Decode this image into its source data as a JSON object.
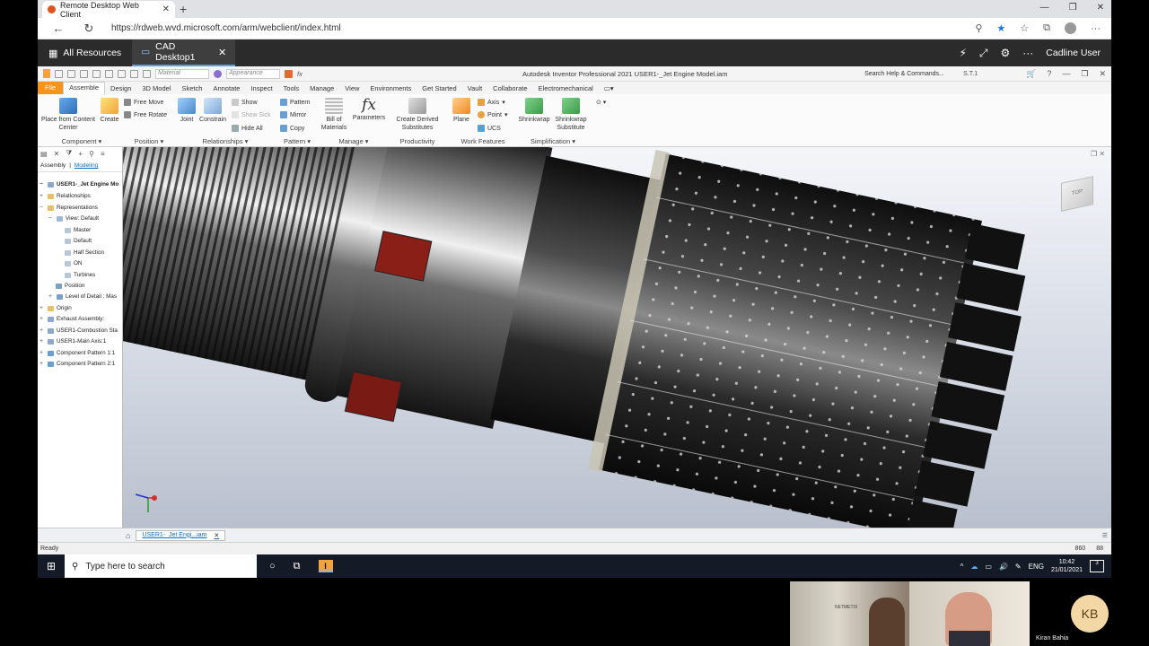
{
  "browser": {
    "tab_title": "Remote Desktop Web Client",
    "new_tab": "+",
    "url": "https://rdweb.wvd.microsoft.com/arm/webclient/index.html",
    "window_controls": [
      "—",
      "❐",
      "✕"
    ]
  },
  "rdclient": {
    "all_resources": "All Resources",
    "session_tab": "CAD Desktop1",
    "user": "Cadline User"
  },
  "inventor": {
    "material_placeholder": "Material",
    "appearance_placeholder": "Appearance",
    "title": "Autodesk Inventor Professional 2021   USER1-_Jet Engine Model.iam",
    "search_help": "Search Help & Commands...",
    "signed_in": "S.T.1",
    "ribbon_tabs": [
      "File",
      "Assemble",
      "Design",
      "3D Model",
      "Sketch",
      "Annotate",
      "Inspect",
      "Tools",
      "Manage",
      "View",
      "Environments",
      "Get Started",
      "Vault",
      "Collaborate",
      "Electromechanical"
    ],
    "active_tab": "Assemble",
    "groups": {
      "component": "Component",
      "position": "Position",
      "relationships": "Relationships",
      "pattern": "Pattern",
      "manage": "Manage",
      "productivity": "Productivity",
      "work_features": "Work Features",
      "simplification": "Simplification"
    },
    "buttons": {
      "place": "Place from Content Center",
      "create": "Create",
      "free_move": "Free Move",
      "free_rotate": "Free Rotate",
      "joint": "Joint",
      "constrain": "Constrain",
      "show": "Show",
      "show_sick": "Show Sick",
      "hide_all": "Hide All",
      "pattern": "Pattern",
      "mirror": "Mirror",
      "copy": "Copy",
      "bom": "Bill of Materials",
      "parameters": "Parameters",
      "derived": "Create Derived Substitutes",
      "plane": "Plane",
      "axis": "Axis",
      "point": "Point",
      "ucs": "UCS",
      "shrinkwrap": "Shrinkwrap",
      "shrinkwrap_sub": "Shrinkwrap Substitute"
    },
    "fx": "fx",
    "browser_panel": {
      "tabs": [
        "Assembly",
        "Modeling"
      ],
      "tree": [
        "USER1-_Jet Engine Mo",
        "Relationships",
        "Representations",
        "View: Default",
        "Master",
        "Default",
        "Half Section",
        "ON",
        "Turbines",
        "Position",
        "Level of Detail : Mas",
        "Origin",
        "Exhaust Assembly:",
        "USER1-Combustion Sta",
        "USER1-Main Axis:1",
        "Component Pattern 1:1",
        "Component Pattern 2:1"
      ]
    },
    "viewcube_label": "TOP",
    "doc_tab": "USER1-_Jet Engi...iam",
    "status": "Ready",
    "status_nums": [
      "860",
      "88"
    ]
  },
  "taskbar": {
    "search_placeholder": "Type here to search",
    "lang": "ENG",
    "time": "10:42",
    "date": "21/01/2021",
    "notifications": "3"
  },
  "meeting": {
    "initials": "KB",
    "name": "Kiran Bahia",
    "room_sign": "NETMETIX"
  }
}
